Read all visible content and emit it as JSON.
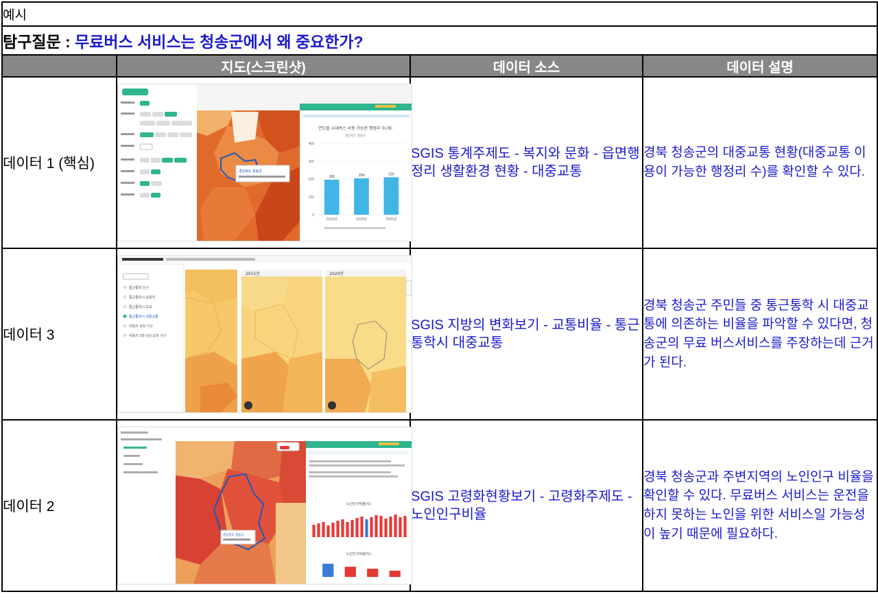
{
  "header": {
    "example_label": "예시",
    "question_prefix": "탐구질문 : ",
    "question_text": "무료버스 서비스는 청송군에서 왜 중요한가?"
  },
  "columns": [
    "지도(스크린샷)",
    "데이터 소스",
    "데이터 설명"
  ],
  "rows": [
    {
      "label": "데이터 1 (핵심)",
      "source": "SGIS 통계주제도 - 복지와 문화 - 읍면행정리 생활환경 현황 - 대중교통",
      "description": "경북 청송군의 대중교통 현황(대중교통 이용이 가능한 행정리 수)를 확인할 수 있다."
    },
    {
      "label": "데이터 3",
      "source": "SGIS 지방의 변화보기 - 교통비율 - 통근통학시 대중교통",
      "description": "경북 청송군 주민들 중 통근통학 시 대중교통에 의존하는 비율을 파악할 수 있다면, 청송군의 무료 버스서비스를 주장하는데 근거가 된다."
    },
    {
      "label": "데이터 2",
      "source": "SGIS 고령화현황보기 - 고령화주제도 - 노인인구비율",
      "description": "경북 청송군과 주변지역의 노인인구 비율을 확인할 수 있다. 무료버스 서비스는 운전을 하지 못하는 노인을 위한 서비스일 가능성이 높기 때문에 필요하다."
    }
  ],
  "shot1": {
    "chart_title": "연도별 시내버스 이용 가능한 행정리 수(개)",
    "chart_subtitle": "경상북도 청송군",
    "popup_title": "경상북도 청송군",
    "chart_data": {
      "type": "bar",
      "categories": [
        "2010년",
        "2015년",
        "2020년"
      ],
      "values": [
        196,
        204,
        210
      ],
      "ylim": [
        0,
        400
      ],
      "yticks": [
        0,
        100,
        200,
        300,
        400
      ],
      "bar_color": "#3fb6e6"
    }
  },
  "shot3": {
    "panel_years": [
      "2015년",
      "2020년"
    ],
    "list_items": [
      "통근통학 인구",
      "통근통학시 승용차",
      "통근통학시 도보",
      "통근통학시 대중교통",
      "자동차 보유 가구",
      "자동차 2대 이상 보유 가구"
    ]
  },
  "shot2": {
    "chart_title": "노인인구비율(%)",
    "chart2_title": "노인인구비율(%)",
    "popup_title": "경상북도 청송군",
    "bars_small": [
      18,
      20,
      22,
      17,
      21,
      24,
      26,
      22,
      25,
      28,
      30,
      26,
      29,
      32,
      31,
      27,
      30,
      33,
      29,
      31
    ],
    "bars_compare": [
      40,
      31,
      25,
      19
    ],
    "bars_compare_colors": [
      "#3a7bd5",
      "#e53935",
      "#e53935",
      "#e53935"
    ]
  }
}
